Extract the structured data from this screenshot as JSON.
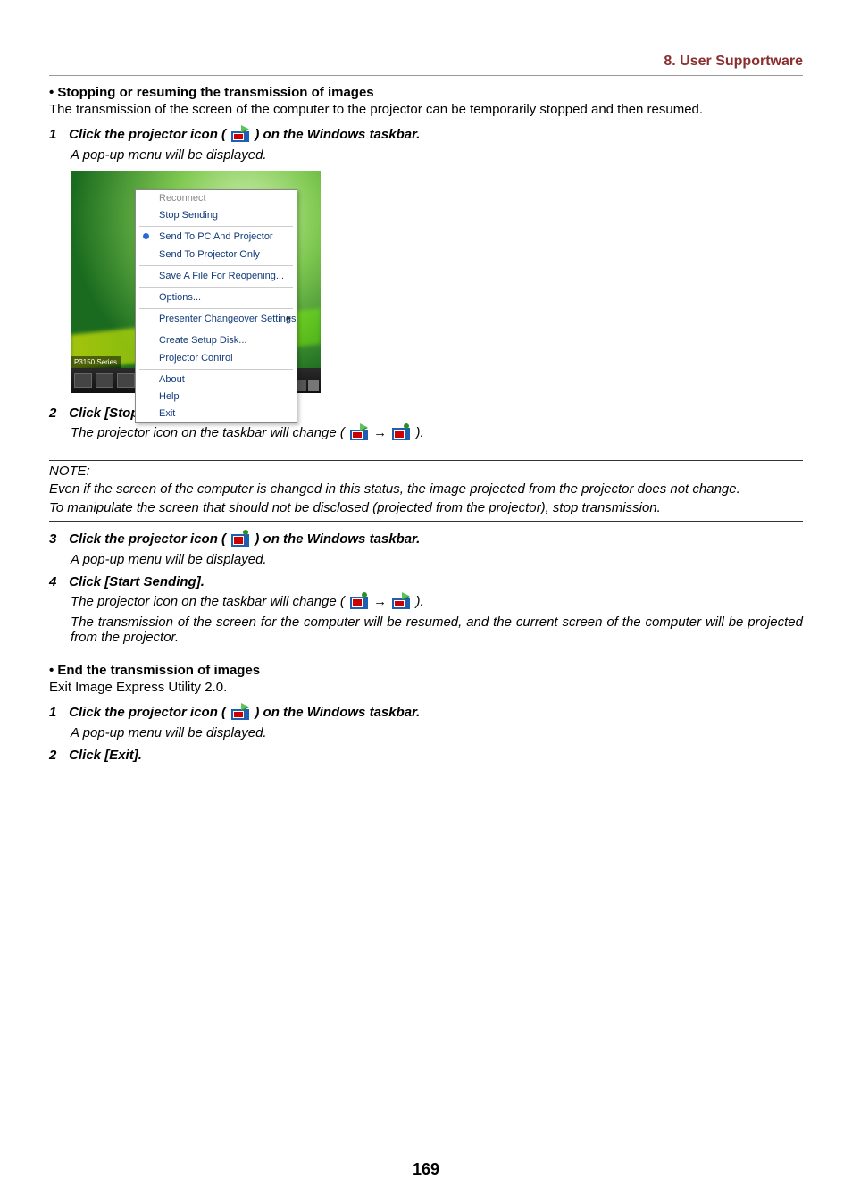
{
  "header": {
    "section": "8. User Supportware"
  },
  "sect1": {
    "title": "• Stopping or resuming the transmission of images",
    "intro": "The transmission of the screen of the computer to the projector can be temporarily stopped and then resumed."
  },
  "steps1": {
    "num1": "1",
    "line1a": "Click the projector icon (",
    "line1b": ") on the Windows taskbar.",
    "popup": "A pop-up menu will be displayed."
  },
  "ctx": {
    "reconnect": "Reconnect",
    "stop": "Stop Sending",
    "sendBoth": "Send To PC And Projector",
    "sendProj": "Send To Projector Only",
    "saveFile": "Save A File For Reopening...",
    "options": "Options...",
    "presenter": "Presenter Changeover Settings",
    "createDisk": "Create Setup Disk...",
    "projControl": "Projector Control",
    "about": "About",
    "help": "Help",
    "exit": "Exit",
    "taskLabel": "P3150 Series"
  },
  "steps2": {
    "num2": "2",
    "line2": "Click [Stop Sending].",
    "change2a": "The projector icon on the taskbar will change (",
    "change2b": ")."
  },
  "note": {
    "label": "NOTE:",
    "line1": "Even if the screen of the computer is changed in this status, the image projected from the projector does not change.",
    "line2": "To manipulate the screen that should not be disclosed (projected from the projector), stop transmission."
  },
  "steps3": {
    "num3": "3",
    "line3a": "Click the projector icon (",
    "line3b": ") on the Windows taskbar.",
    "popup3": "A pop-up menu will be displayed.",
    "num4": "4",
    "line4": "Click [Start Sending].",
    "change4a": "The projector icon on the taskbar will change (",
    "change4b": ").",
    "resume": "The transmission of the screen for the computer will be resumed, and the current screen of the computer will be projected from the projector."
  },
  "sect2": {
    "title": "• End the transmission of images",
    "intro": "Exit Image Express Utility 2.0."
  },
  "steps4": {
    "num1": "1",
    "line1a": "Click the projector icon (",
    "line1b": ") on the Windows taskbar.",
    "popup": "A pop-up menu will be displayed.",
    "num2": "2",
    "line2": "Click [Exit]."
  },
  "icons": {
    "sending": "projector-sending-icon",
    "stopped": "projector-stopped-icon"
  },
  "arrow": "→",
  "pageNumber": "169"
}
